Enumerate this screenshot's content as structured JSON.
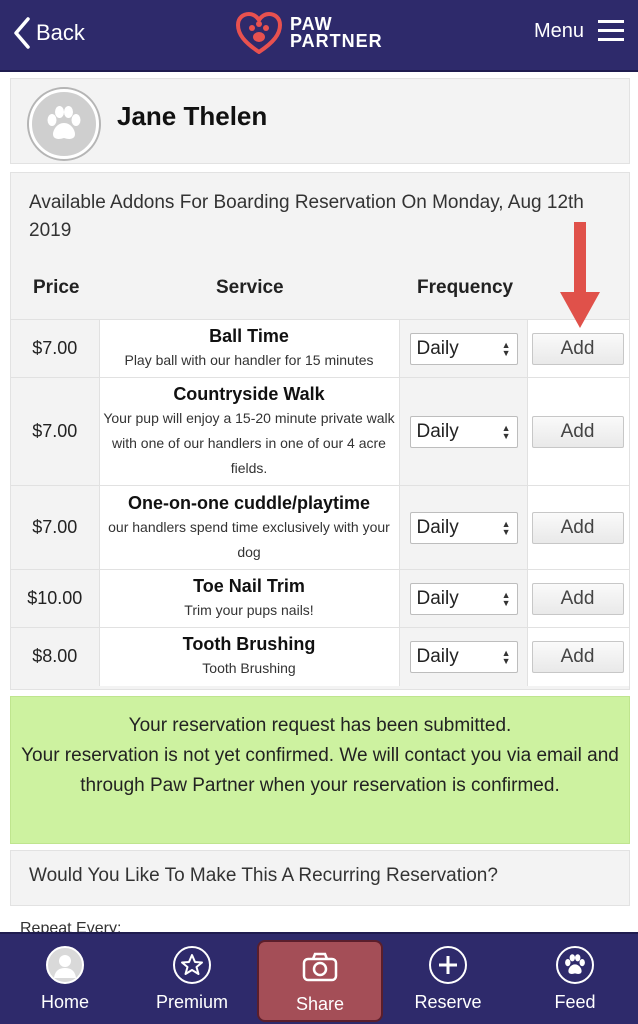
{
  "header": {
    "back_label": "Back",
    "logo_line1": "PAW",
    "logo_line2": "PARTNER",
    "menu_label": "Menu"
  },
  "profile": {
    "name": "Jane Thelen"
  },
  "addons": {
    "title": "Available Addons For Boarding Reservation On Monday, Aug 12th 2019",
    "columns": {
      "price": "Price",
      "service": "Service",
      "frequency": "Frequency"
    },
    "rows": [
      {
        "price": "$7.00",
        "name": "Ball Time",
        "description": "Play ball with our handler for 15 minutes",
        "frequency": "Daily",
        "action": "Add"
      },
      {
        "price": "$7.00",
        "name": "Countryside Walk",
        "description": "Your pup will enjoy a 15-20 minute private walk with one of our handlers in one of our 4 acre fields.",
        "frequency": "Daily",
        "action": "Add"
      },
      {
        "price": "$7.00",
        "name": "One-on-one cuddle/playtime",
        "description": "our handlers spend time exclusively with your dog",
        "frequency": "Daily",
        "action": "Add"
      },
      {
        "price": "$10.00",
        "name": "Toe Nail Trim",
        "description": "Trim your pups nails!",
        "frequency": "Daily",
        "action": "Add"
      },
      {
        "price": "$8.00",
        "name": "Tooth Brushing",
        "description": "Tooth Brushing",
        "frequency": "Daily",
        "action": "Add"
      }
    ]
  },
  "notice": {
    "line1": "Your reservation request has been submitted.",
    "line2": "Your reservation is not yet confirmed. We will contact you via email and through Paw Partner when your reservation is confirmed."
  },
  "recurring": {
    "question": "Would You Like To Make This A Recurring Reservation?",
    "repeat_label": "Repeat Every:"
  },
  "bottom_nav": [
    {
      "label": "Home",
      "icon": "avatar-icon"
    },
    {
      "label": "Premium",
      "icon": "star-icon"
    },
    {
      "label": "Share",
      "icon": "camera-icon"
    },
    {
      "label": "Reserve",
      "icon": "plus-icon"
    },
    {
      "label": "Feed",
      "icon": "paw-icon"
    }
  ],
  "colors": {
    "header_bg": "#2e2a6b",
    "logo_red": "#e8514f",
    "notice_bg": "#cdf2a0",
    "arrow_red": "#e0514a",
    "share_active_bg": "#a44e57"
  }
}
